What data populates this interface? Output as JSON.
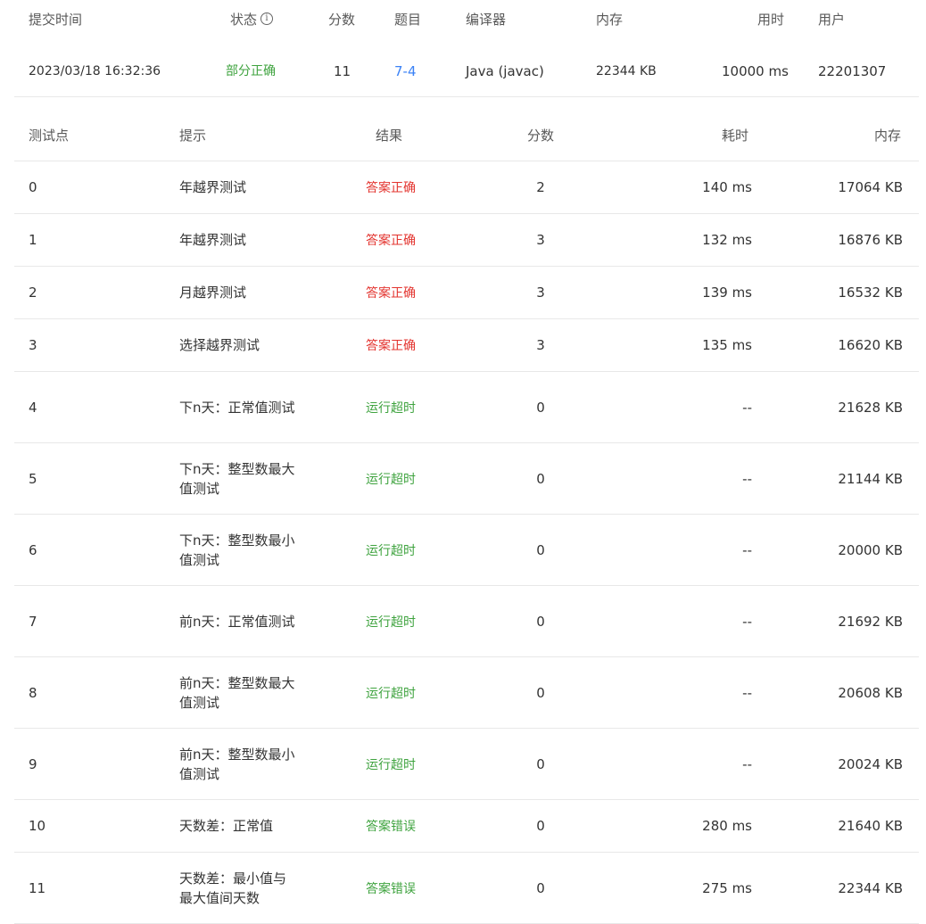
{
  "summary": {
    "headers": {
      "time": "提交时间",
      "status": "状态",
      "score": "分数",
      "problem": "题目",
      "compiler": "编译器",
      "memory": "内存",
      "elapsed": "用时",
      "user": "用户"
    },
    "row": {
      "time": "2023/03/18 16:32:36",
      "status": "部分正确",
      "score": "11",
      "problem": "7-4",
      "compiler": "Java (javac)",
      "memory": "22344 KB",
      "elapsed": "10000 ms",
      "user": "22201307"
    }
  },
  "details": {
    "headers": {
      "case": "测试点",
      "hint": "提示",
      "result": "结果",
      "score": "分数",
      "time": "耗时",
      "memory": "内存"
    },
    "rows": [
      {
        "case": "0",
        "hint": "年越界测试",
        "result": "答案正确",
        "score": "2",
        "time": "140 ms",
        "memory": "17064 KB"
      },
      {
        "case": "1",
        "hint": "年越界测试",
        "result": "答案正确",
        "score": "3",
        "time": "132 ms",
        "memory": "16876 KB"
      },
      {
        "case": "2",
        "hint": "月越界测试",
        "result": "答案正确",
        "score": "3",
        "time": "139 ms",
        "memory": "16532 KB"
      },
      {
        "case": "3",
        "hint": "选择越界测试",
        "result": "答案正确",
        "score": "3",
        "time": "135 ms",
        "memory": "16620 KB"
      },
      {
        "case": "4",
        "hint": "下n天：正常值测试",
        "result": "运行超时",
        "score": "0",
        "time": "--",
        "memory": "21628 KB"
      },
      {
        "case": "5",
        "hint": "下n天：整型数最大值测试",
        "result": "运行超时",
        "score": "0",
        "time": "--",
        "memory": "21144 KB"
      },
      {
        "case": "6",
        "hint": "下n天：整型数最小值测试",
        "result": "运行超时",
        "score": "0",
        "time": "--",
        "memory": "20000 KB"
      },
      {
        "case": "7",
        "hint": "前n天：正常值测试",
        "result": "运行超时",
        "score": "0",
        "time": "--",
        "memory": "21692 KB"
      },
      {
        "case": "8",
        "hint": "前n天：整型数最大值测试",
        "result": "运行超时",
        "score": "0",
        "time": "--",
        "memory": "20608 KB"
      },
      {
        "case": "9",
        "hint": "前n天：整型数最小值测试",
        "result": "运行超时",
        "score": "0",
        "time": "--",
        "memory": "20024 KB"
      },
      {
        "case": "10",
        "hint": "天数差：正常值",
        "result": "答案错误",
        "score": "0",
        "time": "280 ms",
        "memory": "21640 KB"
      },
      {
        "case": "11",
        "hint": "天数差：最小值与最大值间天数",
        "result": "答案错误",
        "score": "0",
        "time": "275 ms",
        "memory": "22344 KB"
      }
    ]
  },
  "colors": {
    "correct": "#e3342f",
    "partial": "#3fa33f",
    "timeout": "#3fa33f",
    "wrong": "#3fa33f",
    "link": "#3b82f6"
  }
}
